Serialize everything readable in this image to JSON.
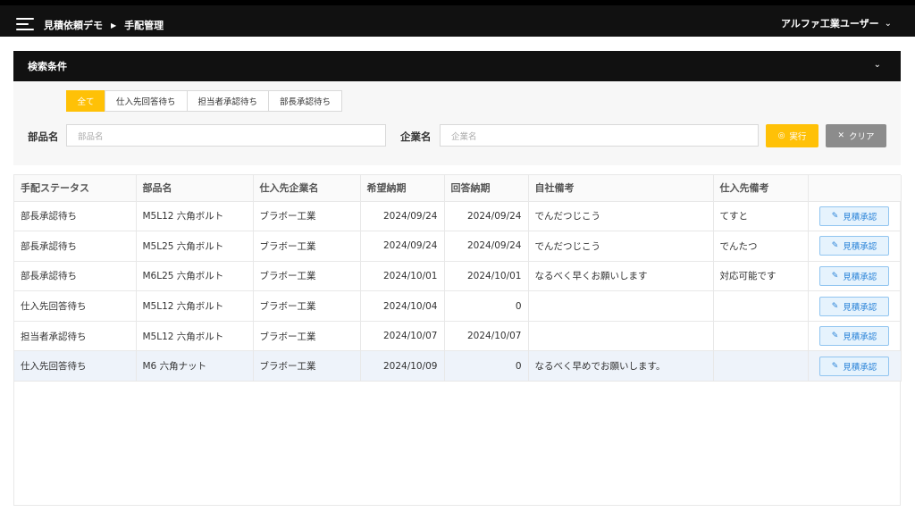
{
  "header": {
    "menu_icon": "hamburger-menu-icon",
    "breadcrumbs": [
      "見積依頼デモ",
      "手配管理"
    ],
    "user": "アルファ工業ユーザー"
  },
  "search": {
    "title": "検索条件",
    "tabs": [
      "全て",
      "仕入先回答待ち",
      "担当者承認待ち",
      "部長承認待ち"
    ],
    "active_tab": "全て",
    "part_label": "部品名",
    "part_placeholder": "部品名",
    "company_label": "企業名",
    "company_placeholder": "企業名",
    "run_label": "実行",
    "clear_label": "クリア"
  },
  "table": {
    "columns": [
      "手配ステータス",
      "部品名",
      "仕入先企業名",
      "希望納期",
      "回答納期",
      "自社備考",
      "仕入先備考",
      ""
    ],
    "action_label": "見積承認",
    "rows": [
      [
        "部長承認待ち",
        "M5L12 六角ボルト",
        "ブラボー工業",
        "2024/09/24",
        "2024/09/24",
        "でんだつじこう",
        "てすと"
      ],
      [
        "部長承認待ち",
        "M5L25 六角ボルト",
        "ブラボー工業",
        "2024/09/24",
        "2024/09/24",
        "でんだつじこう",
        "でんたつ"
      ],
      [
        "部長承認待ち",
        "M6L25 六角ボルト",
        "ブラボー工業",
        "2024/10/01",
        "2024/10/01",
        "なるべく早くお願いします",
        "対応可能です"
      ],
      [
        "仕入先回答待ち",
        "M5L12 六角ボルト",
        "ブラボー工業",
        "2024/10/04",
        "0",
        "",
        ""
      ],
      [
        "担当者承認待ち",
        "M5L12 六角ボルト",
        "ブラボー工業",
        "2024/10/07",
        "2024/10/07",
        "",
        ""
      ],
      [
        "仕入先回答待ち",
        "M6 六角ナット",
        "ブラボー工業",
        "2024/10/09",
        "0",
        "なるべく早めでお願いします。",
        ""
      ]
    ]
  },
  "colors": {
    "accent": "#ffc107",
    "header_bg": "#111111",
    "approve_text": "#2a83d8",
    "clear_bg": "#8c8c8c"
  }
}
